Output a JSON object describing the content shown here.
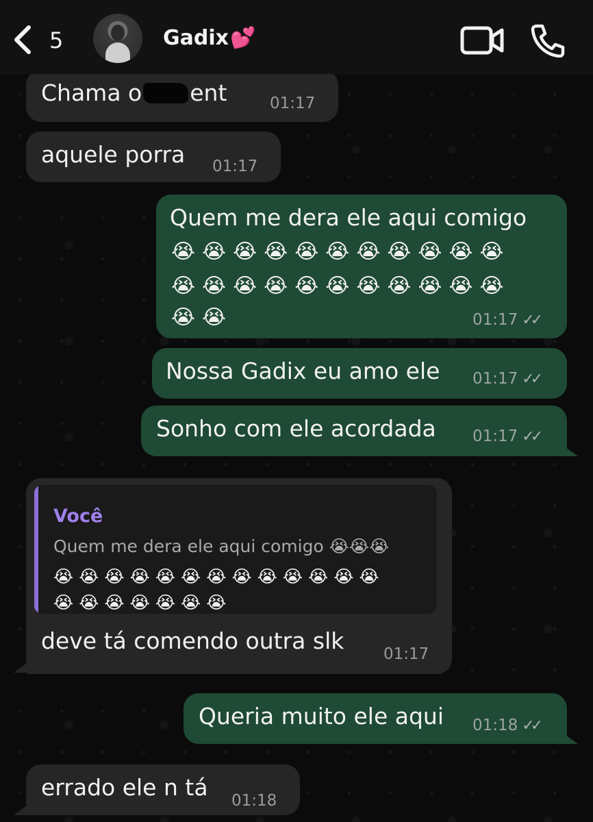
{
  "header": {
    "back_count": "5",
    "contact_name": "Gadix",
    "contact_emoji": "💕",
    "video_icon": "video-camera-icon",
    "call_icon": "phone-icon"
  },
  "messages": [
    {
      "direction": "incoming",
      "text_before": "Chama o",
      "text_after": "ent",
      "time": "01:17",
      "note": "partially scribbled out"
    },
    {
      "direction": "incoming",
      "text": "aquele porra",
      "time": "01:17"
    },
    {
      "direction": "outgoing",
      "text": "Quem me dera ele aqui comigo",
      "emoji_lines": [
        "😭😭😭😭😭😭😭😭😭😭😭",
        "😭😭😭😭😭😭😭😭😭😭😭",
        "😭😭"
      ],
      "time": "01:17",
      "status": "read"
    },
    {
      "direction": "outgoing",
      "text": "Nossa Gadix eu amo ele",
      "time": "01:17",
      "status": "read"
    },
    {
      "direction": "outgoing",
      "text": "Sonho com ele acordada",
      "time": "01:17",
      "status": "read"
    },
    {
      "direction": "incoming",
      "quote": {
        "author": "Você",
        "text": "Quem me dera ele aqui comigo 😭😭😭",
        "emoji_lines": [
          "😭😭😭😭😭😭😭😭😭😭😭😭😭",
          "😭😭😭😭😭😭😭"
        ]
      },
      "text": "deve tá comendo outra slk",
      "time": "01:17"
    },
    {
      "direction": "outgoing",
      "text": "Queria muito ele aqui",
      "time": "01:18",
      "status": "read"
    },
    {
      "direction": "incoming",
      "text": "errado ele n tá",
      "time": "01:18"
    }
  ],
  "colors": {
    "outgoing_bubble": "#1f4a35",
    "incoming_bubble": "#262626",
    "quote_accent": "#8b6fd6",
    "background": "#0b0b0b"
  }
}
